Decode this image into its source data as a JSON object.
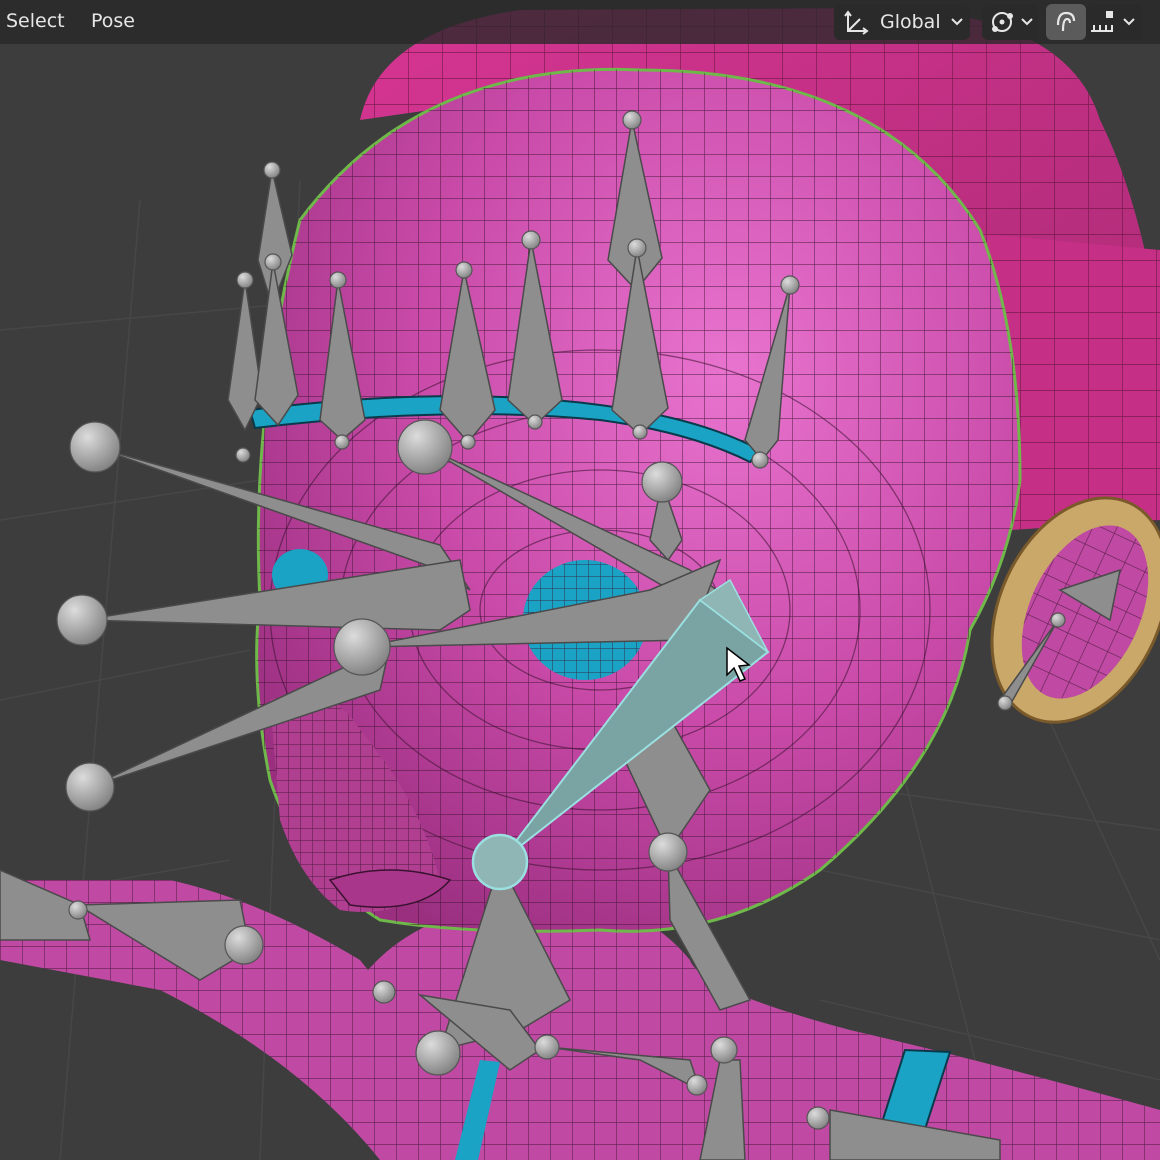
{
  "header": {
    "menus": [
      "Select",
      "Pose"
    ],
    "transform_orientation": "Global",
    "icons": {
      "orientation": "transform-orientation-icon",
      "pivot": "transform-pivot-icon",
      "snap": "snap-magnet-icon",
      "snap_target": "snap-target-icon"
    }
  },
  "viewport": {
    "mode": "Pose",
    "object": "character head with armature bones",
    "selected_bone_color": "#7aa3a3",
    "mesh_color": "#c94aa8",
    "hair_color": "#e0409a",
    "accent_color": "#1aa3c4",
    "ear_ring_color": "#c9a86a",
    "bone_color": "#8e8e8e",
    "background_color": "#3d3d3d"
  }
}
